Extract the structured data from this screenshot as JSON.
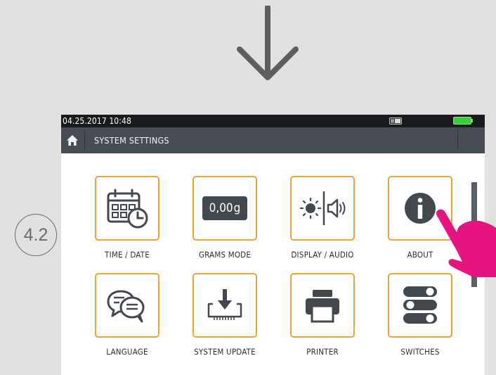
{
  "step": {
    "label": "4.2"
  },
  "status": {
    "datetime": "04.25.2017  10:48"
  },
  "header": {
    "title": "SYSTEM SETTINGS"
  },
  "tiles": [
    {
      "label": "TIME / DATE",
      "icon": "calendar-clock-icon"
    },
    {
      "label": "GRAMS MODE",
      "icon": "grams-display-icon",
      "value": "0,00",
      "unit": "g"
    },
    {
      "label": "DISPLAY / AUDIO",
      "icon": "brightness-speaker-icon"
    },
    {
      "label": "ABOUT",
      "icon": "info-icon"
    },
    {
      "label": "LANGUAGE",
      "icon": "speech-bubbles-icon"
    },
    {
      "label": "SYSTEM UPDATE",
      "icon": "download-tray-icon"
    },
    {
      "label": "PRINTER",
      "icon": "printer-icon"
    },
    {
      "label": "SWITCHES",
      "icon": "toggle-switches-icon"
    }
  ],
  "colors": {
    "tile_border": "#f0a23a",
    "titlebar": "#474c55",
    "statusbar": "#1a1b1e",
    "battery": "#3ccb3c",
    "pointer_hand": "#e6147f",
    "background": "#e1e1e0"
  }
}
